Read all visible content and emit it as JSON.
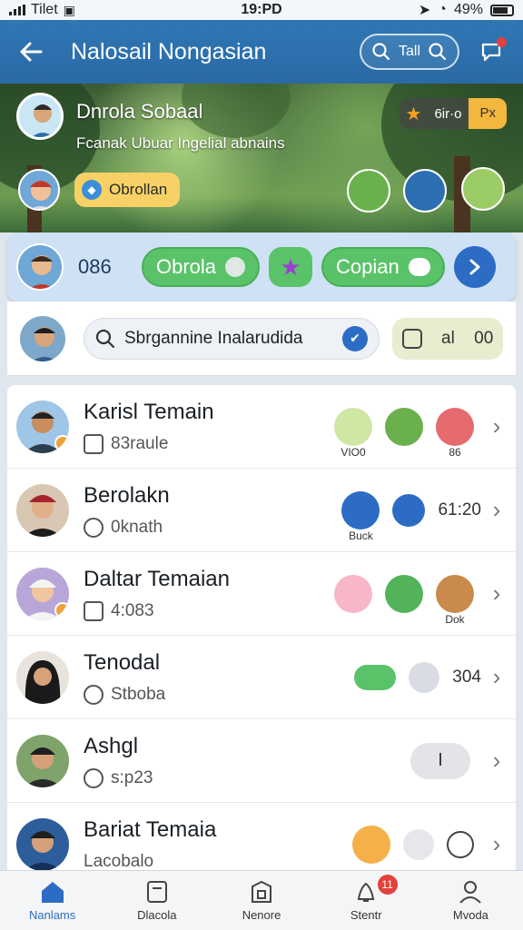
{
  "status_bar": {
    "carrier": "Tilet",
    "time": "19:PD",
    "battery": "49%"
  },
  "app_bar": {
    "title": "Nalosail Nongasian",
    "search_label": "Tall"
  },
  "hero": {
    "name": "Dnrola Sobaal",
    "subtitle": "Fcanak Ubuar Ingelial abnains",
    "chip_text": "6ir·o",
    "chip_badge": "Px",
    "tag_label": "Obrollan"
  },
  "quickbar": {
    "count": "086",
    "action1": "Obrola",
    "action2": "Copian"
  },
  "search": {
    "placeholder": "Sbrgannine Inalarudida",
    "filter_label": "al",
    "filter_count": "00"
  },
  "contacts": [
    {
      "name": "Karisl Temain",
      "meta": "83raule",
      "icon_label": "VIO0",
      "icon3_label": "86",
      "value": ""
    },
    {
      "name": "Berolakn",
      "meta": "0knath",
      "icon_label": "Buck",
      "value": "61:20"
    },
    {
      "name": "Daltar Temaian",
      "meta": "4:083",
      "icon_label": "Dok",
      "value": ""
    },
    {
      "name": "Tenodal",
      "meta": "Stboba",
      "value": "304"
    },
    {
      "name": "Ashgl",
      "meta": "s:p23",
      "pill": "I",
      "value": ""
    },
    {
      "name": "Bariat Temaia",
      "meta": "Lacobalo",
      "value": ""
    }
  ],
  "bottom_nav": [
    {
      "label": "Nanlams",
      "active": true
    },
    {
      "label": "Dlacola"
    },
    {
      "label": "Nenore"
    },
    {
      "label": "Stentr",
      "badge": "11"
    },
    {
      "label": "Mvoda"
    }
  ],
  "colors": {
    "primary": "#2f77b4",
    "accent_green": "#5ac36a",
    "accent_blue": "#2d6cc4",
    "badge_red": "#e3413b",
    "tag_yellow": "#f7d166"
  }
}
